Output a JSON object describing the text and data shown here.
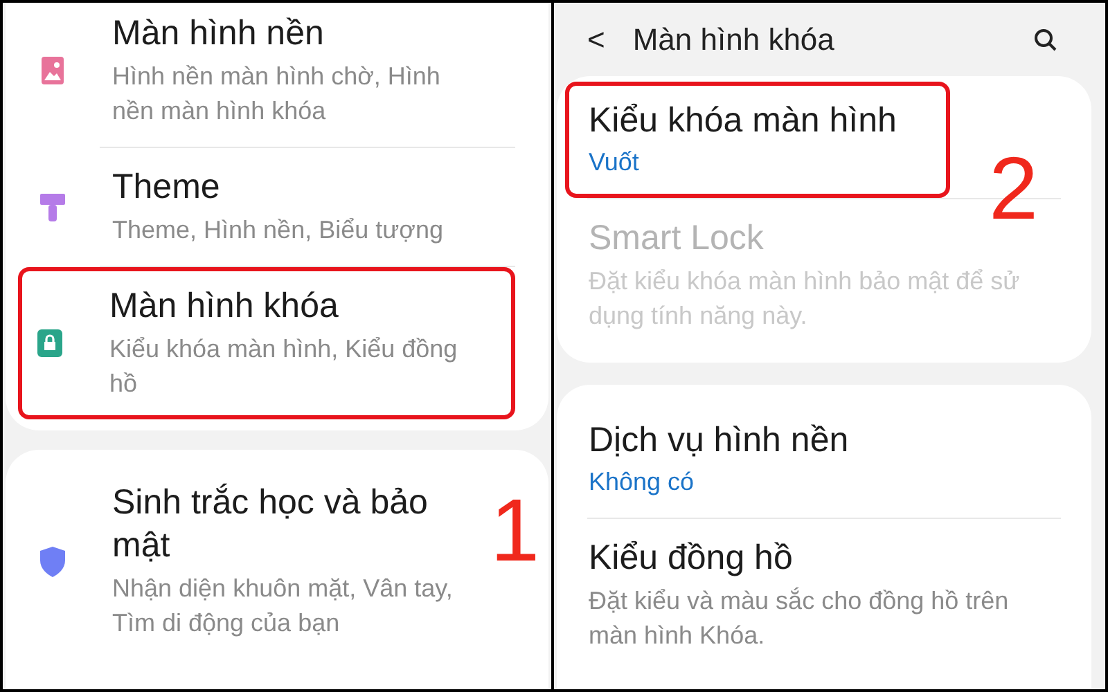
{
  "left": {
    "groups": [
      {
        "items": [
          {
            "title": "Màn hình nền",
            "subtitle": "Hình nền màn hình chờ, Hình nền màn hình khóa",
            "kind": "image",
            "highlighted": false
          },
          {
            "title": "Theme",
            "subtitle": "Theme, Hình nền, Biểu tượng",
            "kind": "brush",
            "highlighted": false
          },
          {
            "title": "Màn hình khóa",
            "subtitle": "Kiểu khóa màn hình, Kiểu đồng hồ",
            "kind": "lock",
            "highlighted": true
          }
        ]
      },
      {
        "items": [
          {
            "title": "Sinh trắc học và bảo mật",
            "subtitle": "Nhận diện khuôn mặt, Vân tay, Tìm di động của bạn",
            "kind": "shield",
            "highlighted": false,
            "annotation": "1"
          }
        ]
      }
    ]
  },
  "right": {
    "header": {
      "back": "<",
      "title": "Màn hình khóa"
    },
    "groups": [
      {
        "items": [
          {
            "title": "Kiểu khóa màn hình",
            "value": "Vuốt",
            "disabled": false,
            "highlighted": true,
            "annotation": "2"
          },
          {
            "title": "Smart Lock",
            "subtitle": "Đặt kiểu khóa màn hình bảo mật để sử dụng tính năng này.",
            "disabled": true,
            "highlighted": false
          }
        ]
      },
      {
        "items": [
          {
            "title": "Dịch vụ hình nền",
            "value": "Không có",
            "disabled": false,
            "highlighted": false
          },
          {
            "title": "Kiểu đồng hồ",
            "subtitle": "Đặt kiểu và màu sắc cho đồng hồ trên màn hình Khóa.",
            "disabled": false,
            "highlighted": false
          }
        ]
      }
    ]
  }
}
